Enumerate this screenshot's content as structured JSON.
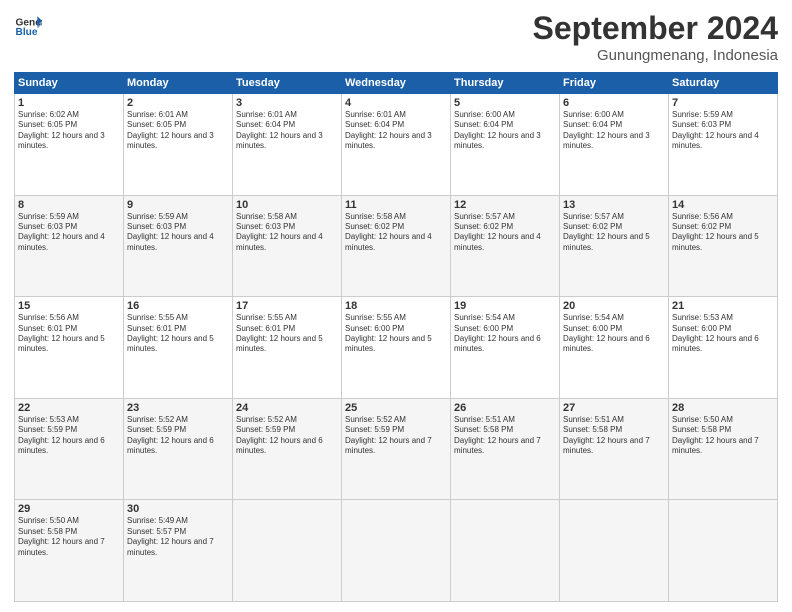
{
  "logo": {
    "text_general": "General",
    "text_blue": "Blue"
  },
  "header": {
    "month": "September 2024",
    "location": "Gunungmenang, Indonesia"
  },
  "days_of_week": [
    "Sunday",
    "Monday",
    "Tuesday",
    "Wednesday",
    "Thursday",
    "Friday",
    "Saturday"
  ],
  "weeks": [
    [
      {
        "day": "1",
        "rise": "6:02 AM",
        "set": "6:05 PM",
        "hours": "12 hours and 3 minutes."
      },
      {
        "day": "2",
        "rise": "6:01 AM",
        "set": "6:05 PM",
        "hours": "12 hours and 3 minutes."
      },
      {
        "day": "3",
        "rise": "6:01 AM",
        "set": "6:04 PM",
        "hours": "12 hours and 3 minutes."
      },
      {
        "day": "4",
        "rise": "6:01 AM",
        "set": "6:04 PM",
        "hours": "12 hours and 3 minutes."
      },
      {
        "day": "5",
        "rise": "6:00 AM",
        "set": "6:04 PM",
        "hours": "12 hours and 3 minutes."
      },
      {
        "day": "6",
        "rise": "6:00 AM",
        "set": "6:04 PM",
        "hours": "12 hours and 3 minutes."
      },
      {
        "day": "7",
        "rise": "5:59 AM",
        "set": "6:03 PM",
        "hours": "12 hours and 4 minutes."
      }
    ],
    [
      {
        "day": "8",
        "rise": "5:59 AM",
        "set": "6:03 PM",
        "hours": "12 hours and 4 minutes."
      },
      {
        "day": "9",
        "rise": "5:59 AM",
        "set": "6:03 PM",
        "hours": "12 hours and 4 minutes."
      },
      {
        "day": "10",
        "rise": "5:58 AM",
        "set": "6:03 PM",
        "hours": "12 hours and 4 minutes."
      },
      {
        "day": "11",
        "rise": "5:58 AM",
        "set": "6:02 PM",
        "hours": "12 hours and 4 minutes."
      },
      {
        "day": "12",
        "rise": "5:57 AM",
        "set": "6:02 PM",
        "hours": "12 hours and 4 minutes."
      },
      {
        "day": "13",
        "rise": "5:57 AM",
        "set": "6:02 PM",
        "hours": "12 hours and 5 minutes."
      },
      {
        "day": "14",
        "rise": "5:56 AM",
        "set": "6:02 PM",
        "hours": "12 hours and 5 minutes."
      }
    ],
    [
      {
        "day": "15",
        "rise": "5:56 AM",
        "set": "6:01 PM",
        "hours": "12 hours and 5 minutes."
      },
      {
        "day": "16",
        "rise": "5:55 AM",
        "set": "6:01 PM",
        "hours": "12 hours and 5 minutes."
      },
      {
        "day": "17",
        "rise": "5:55 AM",
        "set": "6:01 PM",
        "hours": "12 hours and 5 minutes."
      },
      {
        "day": "18",
        "rise": "5:55 AM",
        "set": "6:00 PM",
        "hours": "12 hours and 5 minutes."
      },
      {
        "day": "19",
        "rise": "5:54 AM",
        "set": "6:00 PM",
        "hours": "12 hours and 6 minutes."
      },
      {
        "day": "20",
        "rise": "5:54 AM",
        "set": "6:00 PM",
        "hours": "12 hours and 6 minutes."
      },
      {
        "day": "21",
        "rise": "5:53 AM",
        "set": "6:00 PM",
        "hours": "12 hours and 6 minutes."
      }
    ],
    [
      {
        "day": "22",
        "rise": "5:53 AM",
        "set": "5:59 PM",
        "hours": "12 hours and 6 minutes."
      },
      {
        "day": "23",
        "rise": "5:52 AM",
        "set": "5:59 PM",
        "hours": "12 hours and 6 minutes."
      },
      {
        "day": "24",
        "rise": "5:52 AM",
        "set": "5:59 PM",
        "hours": "12 hours and 6 minutes."
      },
      {
        "day": "25",
        "rise": "5:52 AM",
        "set": "5:59 PM",
        "hours": "12 hours and 7 minutes."
      },
      {
        "day": "26",
        "rise": "5:51 AM",
        "set": "5:58 PM",
        "hours": "12 hours and 7 minutes."
      },
      {
        "day": "27",
        "rise": "5:51 AM",
        "set": "5:58 PM",
        "hours": "12 hours and 7 minutes."
      },
      {
        "day": "28",
        "rise": "5:50 AM",
        "set": "5:58 PM",
        "hours": "12 hours and 7 minutes."
      }
    ],
    [
      {
        "day": "29",
        "rise": "5:50 AM",
        "set": "5:58 PM",
        "hours": "12 hours and 7 minutes."
      },
      {
        "day": "30",
        "rise": "5:49 AM",
        "set": "5:57 PM",
        "hours": "12 hours and 7 minutes."
      },
      null,
      null,
      null,
      null,
      null
    ]
  ],
  "labels": {
    "sunrise": "Sunrise:",
    "sunset": "Sunset:",
    "daylight": "Daylight:"
  }
}
